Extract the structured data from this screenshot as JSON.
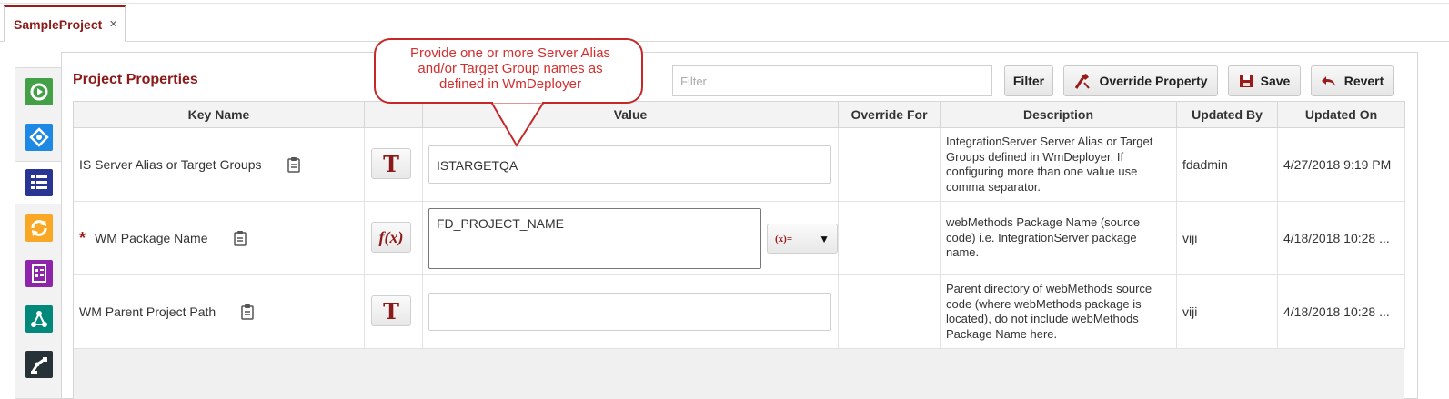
{
  "project_tab": {
    "label": "SampleProject",
    "close_glyph": "×"
  },
  "panel": {
    "title": "Project Properties"
  },
  "toolbar": {
    "filter_placeholder": "Filter",
    "filter_button": "Filter",
    "override_button": "Override Property",
    "save_button": "Save",
    "revert_button": "Revert"
  },
  "columns": {
    "key_name": "Key Name",
    "type": "",
    "value": "Value",
    "override_for": "Override For",
    "description": "Description",
    "updated_by": "Updated By",
    "updated_on": "Updated On"
  },
  "rows": [
    {
      "key": "IS Server Alias or Target Groups",
      "required": false,
      "type_glyph": "T",
      "value": "ISTARGETQA",
      "override_for": "",
      "description": "IntegrationServer Server Alias or Target Groups defined in WmDeployer. If configuring more than one value use comma separator.",
      "updated_by": "fdadmin",
      "updated_on": "4/27/2018 9:19 PM"
    },
    {
      "key": "WM Package Name",
      "required": true,
      "required_mark": "*",
      "type_glyph": "f(x)",
      "value": "FD_PROJECT_NAME",
      "expression_label": "(x)=",
      "override_for": "",
      "description": "webMethods Package Name (source code) i.e. IntegrationServer package name.",
      "updated_by": "viji",
      "updated_on": "4/18/2018 10:28 ..."
    },
    {
      "key": "WM Parent Project Path",
      "required": false,
      "type_glyph": "T",
      "value": "",
      "override_for": "",
      "description": "Parent directory of webMethods source code (where webMethods package is located), do not include webMethods Package Name here.",
      "updated_by": "viji",
      "updated_on": "4/18/2018 10:28 ..."
    }
  ],
  "callout": {
    "text": "Provide one or more Server Alias and/or Target Group names as defined in WmDeployer"
  },
  "colors": {
    "brand": "#8b1a1a",
    "callout": "#d32f2f"
  },
  "rail_icons": [
    "build-icon",
    "integration-icon",
    "properties-icon",
    "sync-icon",
    "checklist-icon",
    "topology-icon",
    "robot-icon"
  ]
}
